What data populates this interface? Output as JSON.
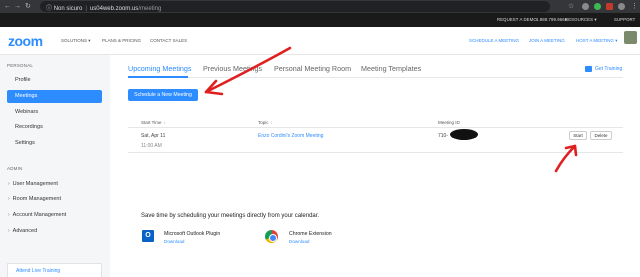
{
  "browser": {
    "security": "Non sicuro",
    "url_host": "us04web.zoom.us",
    "url_path": "/meeting"
  },
  "topbar": {
    "request_demo": "REQUEST A DEMO",
    "phone": "1.888.799.9666",
    "resources": "RESOURCES",
    "support": "SUPPORT"
  },
  "header": {
    "logo": "zoom",
    "nav": {
      "solutions": "SOLUTIONS",
      "plans": "PLANS & PRICING",
      "contact": "CONTACT SALES"
    },
    "actions": {
      "schedule": "SCHEDULE A MEETING",
      "join": "JOIN A MEETING",
      "host": "HOST A MEETING"
    }
  },
  "sidebar": {
    "personal_label": "PERSONAL",
    "personal_items": [
      "Profile",
      "Meetings",
      "Webinars",
      "Recordings",
      "Settings"
    ],
    "admin_label": "ADMIN",
    "admin_items": [
      "User Management",
      "Room Management",
      "Account Management",
      "Advanced"
    ],
    "training": "Attend Live Training"
  },
  "tabs": [
    "Upcoming Meetings",
    "Previous Meetings",
    "Personal Meeting Room",
    "Meeting Templates"
  ],
  "get_training": "Get Training",
  "schedule_button": "Schedule a New Meeting",
  "table": {
    "headers": {
      "start_time": "Start Time",
      "topic": "Topic",
      "meeting_id": "Meeting ID"
    },
    "rows": [
      {
        "date": "Sat, Apr 11",
        "time": "11:00 AM",
        "topic": "Enzo Cordini's Zoom Meeting",
        "meeting_id": "710-",
        "start": "Start",
        "delete": "Delete"
      }
    ]
  },
  "promo": {
    "title": "Save time by scheduling your meetings directly from your calendar.",
    "plugins": [
      {
        "name": "Microsoft Outlook Plugin",
        "download": "Download",
        "icon": "outlook-icon"
      },
      {
        "name": "Chrome Extension",
        "download": "Download",
        "icon": "chrome-icon"
      }
    ]
  },
  "colors": {
    "accent": "#2d8cff",
    "topbar": "#1a1a1a",
    "annotation": "#e02020"
  }
}
